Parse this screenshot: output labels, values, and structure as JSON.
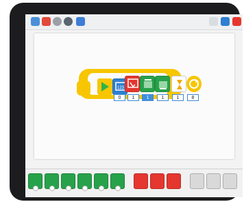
{
  "colors": {
    "green": "#27a24a",
    "red": "#e5362f",
    "blue": "#2e7fd1",
    "yellow": "#f7c600",
    "start": "#2fb34a"
  },
  "toolbar": {
    "icons": [
      "home-icon",
      "project-icon",
      "gallery-icon",
      "record-icon",
      "document-icon",
      "help-icon",
      "blue-square-icon",
      "red-square-icon"
    ]
  },
  "program": {
    "start_param": "0",
    "loop_params": [
      "1",
      "1",
      "1",
      "1",
      "8"
    ]
  },
  "palette": {
    "green_blocks": [
      "motor-clockwise",
      "motor-counterclockwise",
      "motor-stop",
      "motor-power",
      "motor-on-for",
      "motor-off"
    ],
    "red_blocks": [
      "sound-block",
      "display-block",
      "screen-block"
    ]
  }
}
